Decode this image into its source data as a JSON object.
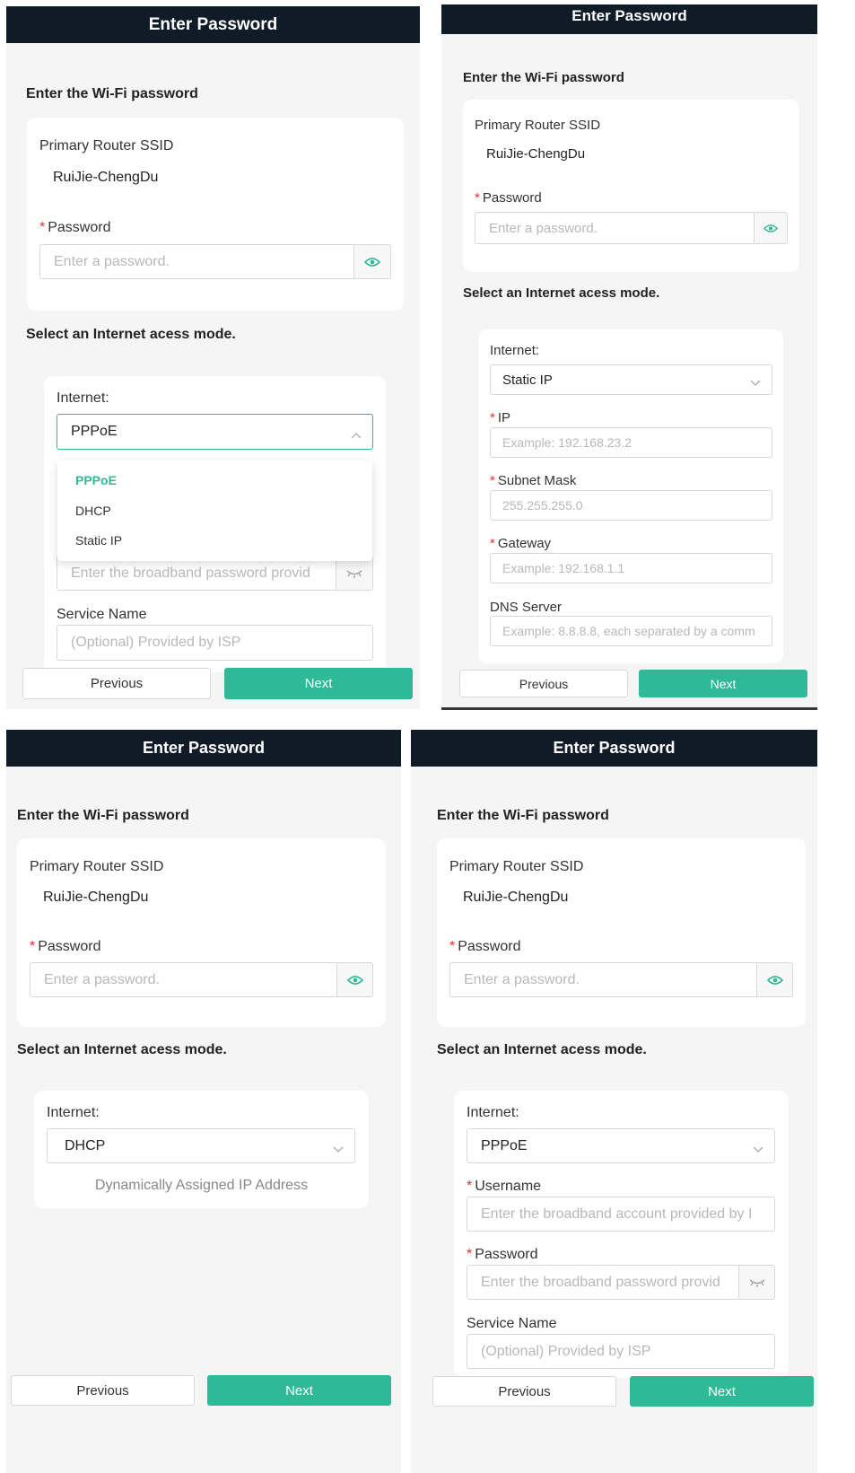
{
  "header_title": "Enter Password",
  "wifi_section_title": "Enter the Wi-Fi password",
  "ssid_label": "Primary Router SSID",
  "ssid_value": "RuiJie-ChengDu",
  "required_mark": "*",
  "password_label": "Password",
  "password_placeholder": "Enter a password.",
  "internet_section_title": "Select an Internet acess mode.",
  "internet_label": "Internet:",
  "modes": {
    "pppoe": "PPPoE",
    "dhcp": "DHCP",
    "static": "Static IP"
  },
  "dropdown_options": [
    "PPPoE",
    "DHCP",
    "Static IP"
  ],
  "pppoe": {
    "username_label": "Username",
    "username_placeholder": "Enter the broadband account provided by I",
    "password_label": "Password",
    "password_placeholder": "Enter the broadband password provid",
    "service_label": "Service Name",
    "service_placeholder": "(Optional) Provided by ISP"
  },
  "static": {
    "ip_label": "IP",
    "ip_placeholder": "Example: 192.168.23.2",
    "mask_label": "Subnet Mask",
    "mask_placeholder": "255.255.255.0",
    "gateway_label": "Gateway",
    "gateway_placeholder": "Example: 192.168.1.1",
    "dns_label": "DNS Server",
    "dns_placeholder": "Example: 8.8.8.8, each separated by a comm"
  },
  "dhcp_note": "Dynamically Assigned IP Address",
  "previous_label": "Previous",
  "next_label": "Next",
  "colors": {
    "accent": "#2fb997",
    "header": "#0f1b27",
    "required": "#e0302f"
  },
  "icons": {
    "show_password": "eye-icon",
    "hidden_password": "eye-closed-icon",
    "select": "chevron-down-icon",
    "select_open": "chevron-up-icon"
  }
}
